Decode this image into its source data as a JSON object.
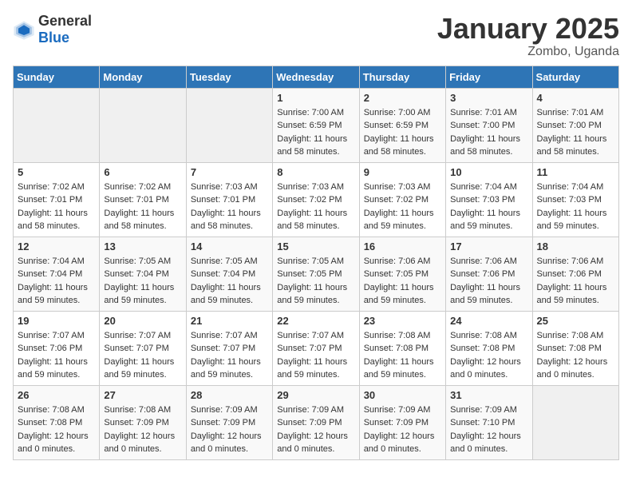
{
  "header": {
    "logo_general": "General",
    "logo_blue": "Blue",
    "month_title": "January 2025",
    "location": "Zombo, Uganda"
  },
  "days_of_week": [
    "Sunday",
    "Monday",
    "Tuesday",
    "Wednesday",
    "Thursday",
    "Friday",
    "Saturday"
  ],
  "weeks": [
    [
      {
        "day": "",
        "sunrise": "",
        "sunset": "",
        "daylight": ""
      },
      {
        "day": "",
        "sunrise": "",
        "sunset": "",
        "daylight": ""
      },
      {
        "day": "",
        "sunrise": "",
        "sunset": "",
        "daylight": ""
      },
      {
        "day": "1",
        "sunrise": "Sunrise: 7:00 AM",
        "sunset": "Sunset: 6:59 PM",
        "daylight": "Daylight: 11 hours and 58 minutes."
      },
      {
        "day": "2",
        "sunrise": "Sunrise: 7:00 AM",
        "sunset": "Sunset: 6:59 PM",
        "daylight": "Daylight: 11 hours and 58 minutes."
      },
      {
        "day": "3",
        "sunrise": "Sunrise: 7:01 AM",
        "sunset": "Sunset: 7:00 PM",
        "daylight": "Daylight: 11 hours and 58 minutes."
      },
      {
        "day": "4",
        "sunrise": "Sunrise: 7:01 AM",
        "sunset": "Sunset: 7:00 PM",
        "daylight": "Daylight: 11 hours and 58 minutes."
      }
    ],
    [
      {
        "day": "5",
        "sunrise": "Sunrise: 7:02 AM",
        "sunset": "Sunset: 7:01 PM",
        "daylight": "Daylight: 11 hours and 58 minutes."
      },
      {
        "day": "6",
        "sunrise": "Sunrise: 7:02 AM",
        "sunset": "Sunset: 7:01 PM",
        "daylight": "Daylight: 11 hours and 58 minutes."
      },
      {
        "day": "7",
        "sunrise": "Sunrise: 7:03 AM",
        "sunset": "Sunset: 7:01 PM",
        "daylight": "Daylight: 11 hours and 58 minutes."
      },
      {
        "day": "8",
        "sunrise": "Sunrise: 7:03 AM",
        "sunset": "Sunset: 7:02 PM",
        "daylight": "Daylight: 11 hours and 58 minutes."
      },
      {
        "day": "9",
        "sunrise": "Sunrise: 7:03 AM",
        "sunset": "Sunset: 7:02 PM",
        "daylight": "Daylight: 11 hours and 59 minutes."
      },
      {
        "day": "10",
        "sunrise": "Sunrise: 7:04 AM",
        "sunset": "Sunset: 7:03 PM",
        "daylight": "Daylight: 11 hours and 59 minutes."
      },
      {
        "day": "11",
        "sunrise": "Sunrise: 7:04 AM",
        "sunset": "Sunset: 7:03 PM",
        "daylight": "Daylight: 11 hours and 59 minutes."
      }
    ],
    [
      {
        "day": "12",
        "sunrise": "Sunrise: 7:04 AM",
        "sunset": "Sunset: 7:04 PM",
        "daylight": "Daylight: 11 hours and 59 minutes."
      },
      {
        "day": "13",
        "sunrise": "Sunrise: 7:05 AM",
        "sunset": "Sunset: 7:04 PM",
        "daylight": "Daylight: 11 hours and 59 minutes."
      },
      {
        "day": "14",
        "sunrise": "Sunrise: 7:05 AM",
        "sunset": "Sunset: 7:04 PM",
        "daylight": "Daylight: 11 hours and 59 minutes."
      },
      {
        "day": "15",
        "sunrise": "Sunrise: 7:05 AM",
        "sunset": "Sunset: 7:05 PM",
        "daylight": "Daylight: 11 hours and 59 minutes."
      },
      {
        "day": "16",
        "sunrise": "Sunrise: 7:06 AM",
        "sunset": "Sunset: 7:05 PM",
        "daylight": "Daylight: 11 hours and 59 minutes."
      },
      {
        "day": "17",
        "sunrise": "Sunrise: 7:06 AM",
        "sunset": "Sunset: 7:06 PM",
        "daylight": "Daylight: 11 hours and 59 minutes."
      },
      {
        "day": "18",
        "sunrise": "Sunrise: 7:06 AM",
        "sunset": "Sunset: 7:06 PM",
        "daylight": "Daylight: 11 hours and 59 minutes."
      }
    ],
    [
      {
        "day": "19",
        "sunrise": "Sunrise: 7:07 AM",
        "sunset": "Sunset: 7:06 PM",
        "daylight": "Daylight: 11 hours and 59 minutes."
      },
      {
        "day": "20",
        "sunrise": "Sunrise: 7:07 AM",
        "sunset": "Sunset: 7:07 PM",
        "daylight": "Daylight: 11 hours and 59 minutes."
      },
      {
        "day": "21",
        "sunrise": "Sunrise: 7:07 AM",
        "sunset": "Sunset: 7:07 PM",
        "daylight": "Daylight: 11 hours and 59 minutes."
      },
      {
        "day": "22",
        "sunrise": "Sunrise: 7:07 AM",
        "sunset": "Sunset: 7:07 PM",
        "daylight": "Daylight: 11 hours and 59 minutes."
      },
      {
        "day": "23",
        "sunrise": "Sunrise: 7:08 AM",
        "sunset": "Sunset: 7:08 PM",
        "daylight": "Daylight: 11 hours and 59 minutes."
      },
      {
        "day": "24",
        "sunrise": "Sunrise: 7:08 AM",
        "sunset": "Sunset: 7:08 PM",
        "daylight": "Daylight: 12 hours and 0 minutes."
      },
      {
        "day": "25",
        "sunrise": "Sunrise: 7:08 AM",
        "sunset": "Sunset: 7:08 PM",
        "daylight": "Daylight: 12 hours and 0 minutes."
      }
    ],
    [
      {
        "day": "26",
        "sunrise": "Sunrise: 7:08 AM",
        "sunset": "Sunset: 7:08 PM",
        "daylight": "Daylight: 12 hours and 0 minutes."
      },
      {
        "day": "27",
        "sunrise": "Sunrise: 7:08 AM",
        "sunset": "Sunset: 7:09 PM",
        "daylight": "Daylight: 12 hours and 0 minutes."
      },
      {
        "day": "28",
        "sunrise": "Sunrise: 7:09 AM",
        "sunset": "Sunset: 7:09 PM",
        "daylight": "Daylight: 12 hours and 0 minutes."
      },
      {
        "day": "29",
        "sunrise": "Sunrise: 7:09 AM",
        "sunset": "Sunset: 7:09 PM",
        "daylight": "Daylight: 12 hours and 0 minutes."
      },
      {
        "day": "30",
        "sunrise": "Sunrise: 7:09 AM",
        "sunset": "Sunset: 7:09 PM",
        "daylight": "Daylight: 12 hours and 0 minutes."
      },
      {
        "day": "31",
        "sunrise": "Sunrise: 7:09 AM",
        "sunset": "Sunset: 7:10 PM",
        "daylight": "Daylight: 12 hours and 0 minutes."
      },
      {
        "day": "",
        "sunrise": "",
        "sunset": "",
        "daylight": ""
      }
    ]
  ]
}
